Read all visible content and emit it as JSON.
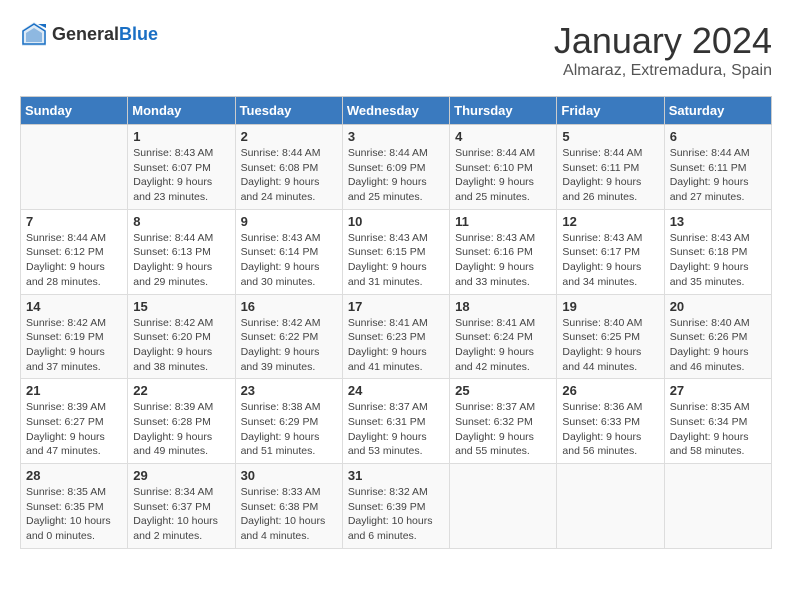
{
  "header": {
    "logo_general": "General",
    "logo_blue": "Blue",
    "month": "January 2024",
    "location": "Almaraz, Extremadura, Spain"
  },
  "days_of_week": [
    "Sunday",
    "Monday",
    "Tuesday",
    "Wednesday",
    "Thursday",
    "Friday",
    "Saturday"
  ],
  "weeks": [
    [
      {
        "day": "",
        "info": ""
      },
      {
        "day": "1",
        "info": "Sunrise: 8:43 AM\nSunset: 6:07 PM\nDaylight: 9 hours\nand 23 minutes."
      },
      {
        "day": "2",
        "info": "Sunrise: 8:44 AM\nSunset: 6:08 PM\nDaylight: 9 hours\nand 24 minutes."
      },
      {
        "day": "3",
        "info": "Sunrise: 8:44 AM\nSunset: 6:09 PM\nDaylight: 9 hours\nand 25 minutes."
      },
      {
        "day": "4",
        "info": "Sunrise: 8:44 AM\nSunset: 6:10 PM\nDaylight: 9 hours\nand 25 minutes."
      },
      {
        "day": "5",
        "info": "Sunrise: 8:44 AM\nSunset: 6:11 PM\nDaylight: 9 hours\nand 26 minutes."
      },
      {
        "day": "6",
        "info": "Sunrise: 8:44 AM\nSunset: 6:11 PM\nDaylight: 9 hours\nand 27 minutes."
      }
    ],
    [
      {
        "day": "7",
        "info": "Sunrise: 8:44 AM\nSunset: 6:12 PM\nDaylight: 9 hours\nand 28 minutes."
      },
      {
        "day": "8",
        "info": "Sunrise: 8:44 AM\nSunset: 6:13 PM\nDaylight: 9 hours\nand 29 minutes."
      },
      {
        "day": "9",
        "info": "Sunrise: 8:43 AM\nSunset: 6:14 PM\nDaylight: 9 hours\nand 30 minutes."
      },
      {
        "day": "10",
        "info": "Sunrise: 8:43 AM\nSunset: 6:15 PM\nDaylight: 9 hours\nand 31 minutes."
      },
      {
        "day": "11",
        "info": "Sunrise: 8:43 AM\nSunset: 6:16 PM\nDaylight: 9 hours\nand 33 minutes."
      },
      {
        "day": "12",
        "info": "Sunrise: 8:43 AM\nSunset: 6:17 PM\nDaylight: 9 hours\nand 34 minutes."
      },
      {
        "day": "13",
        "info": "Sunrise: 8:43 AM\nSunset: 6:18 PM\nDaylight: 9 hours\nand 35 minutes."
      }
    ],
    [
      {
        "day": "14",
        "info": "Sunrise: 8:42 AM\nSunset: 6:19 PM\nDaylight: 9 hours\nand 37 minutes."
      },
      {
        "day": "15",
        "info": "Sunrise: 8:42 AM\nSunset: 6:20 PM\nDaylight: 9 hours\nand 38 minutes."
      },
      {
        "day": "16",
        "info": "Sunrise: 8:42 AM\nSunset: 6:22 PM\nDaylight: 9 hours\nand 39 minutes."
      },
      {
        "day": "17",
        "info": "Sunrise: 8:41 AM\nSunset: 6:23 PM\nDaylight: 9 hours\nand 41 minutes."
      },
      {
        "day": "18",
        "info": "Sunrise: 8:41 AM\nSunset: 6:24 PM\nDaylight: 9 hours\nand 42 minutes."
      },
      {
        "day": "19",
        "info": "Sunrise: 8:40 AM\nSunset: 6:25 PM\nDaylight: 9 hours\nand 44 minutes."
      },
      {
        "day": "20",
        "info": "Sunrise: 8:40 AM\nSunset: 6:26 PM\nDaylight: 9 hours\nand 46 minutes."
      }
    ],
    [
      {
        "day": "21",
        "info": "Sunrise: 8:39 AM\nSunset: 6:27 PM\nDaylight: 9 hours\nand 47 minutes."
      },
      {
        "day": "22",
        "info": "Sunrise: 8:39 AM\nSunset: 6:28 PM\nDaylight: 9 hours\nand 49 minutes."
      },
      {
        "day": "23",
        "info": "Sunrise: 8:38 AM\nSunset: 6:29 PM\nDaylight: 9 hours\nand 51 minutes."
      },
      {
        "day": "24",
        "info": "Sunrise: 8:37 AM\nSunset: 6:31 PM\nDaylight: 9 hours\nand 53 minutes."
      },
      {
        "day": "25",
        "info": "Sunrise: 8:37 AM\nSunset: 6:32 PM\nDaylight: 9 hours\nand 55 minutes."
      },
      {
        "day": "26",
        "info": "Sunrise: 8:36 AM\nSunset: 6:33 PM\nDaylight: 9 hours\nand 56 minutes."
      },
      {
        "day": "27",
        "info": "Sunrise: 8:35 AM\nSunset: 6:34 PM\nDaylight: 9 hours\nand 58 minutes."
      }
    ],
    [
      {
        "day": "28",
        "info": "Sunrise: 8:35 AM\nSunset: 6:35 PM\nDaylight: 10 hours\nand 0 minutes."
      },
      {
        "day": "29",
        "info": "Sunrise: 8:34 AM\nSunset: 6:37 PM\nDaylight: 10 hours\nand 2 minutes."
      },
      {
        "day": "30",
        "info": "Sunrise: 8:33 AM\nSunset: 6:38 PM\nDaylight: 10 hours\nand 4 minutes."
      },
      {
        "day": "31",
        "info": "Sunrise: 8:32 AM\nSunset: 6:39 PM\nDaylight: 10 hours\nand 6 minutes."
      },
      {
        "day": "",
        "info": ""
      },
      {
        "day": "",
        "info": ""
      },
      {
        "day": "",
        "info": ""
      }
    ]
  ]
}
